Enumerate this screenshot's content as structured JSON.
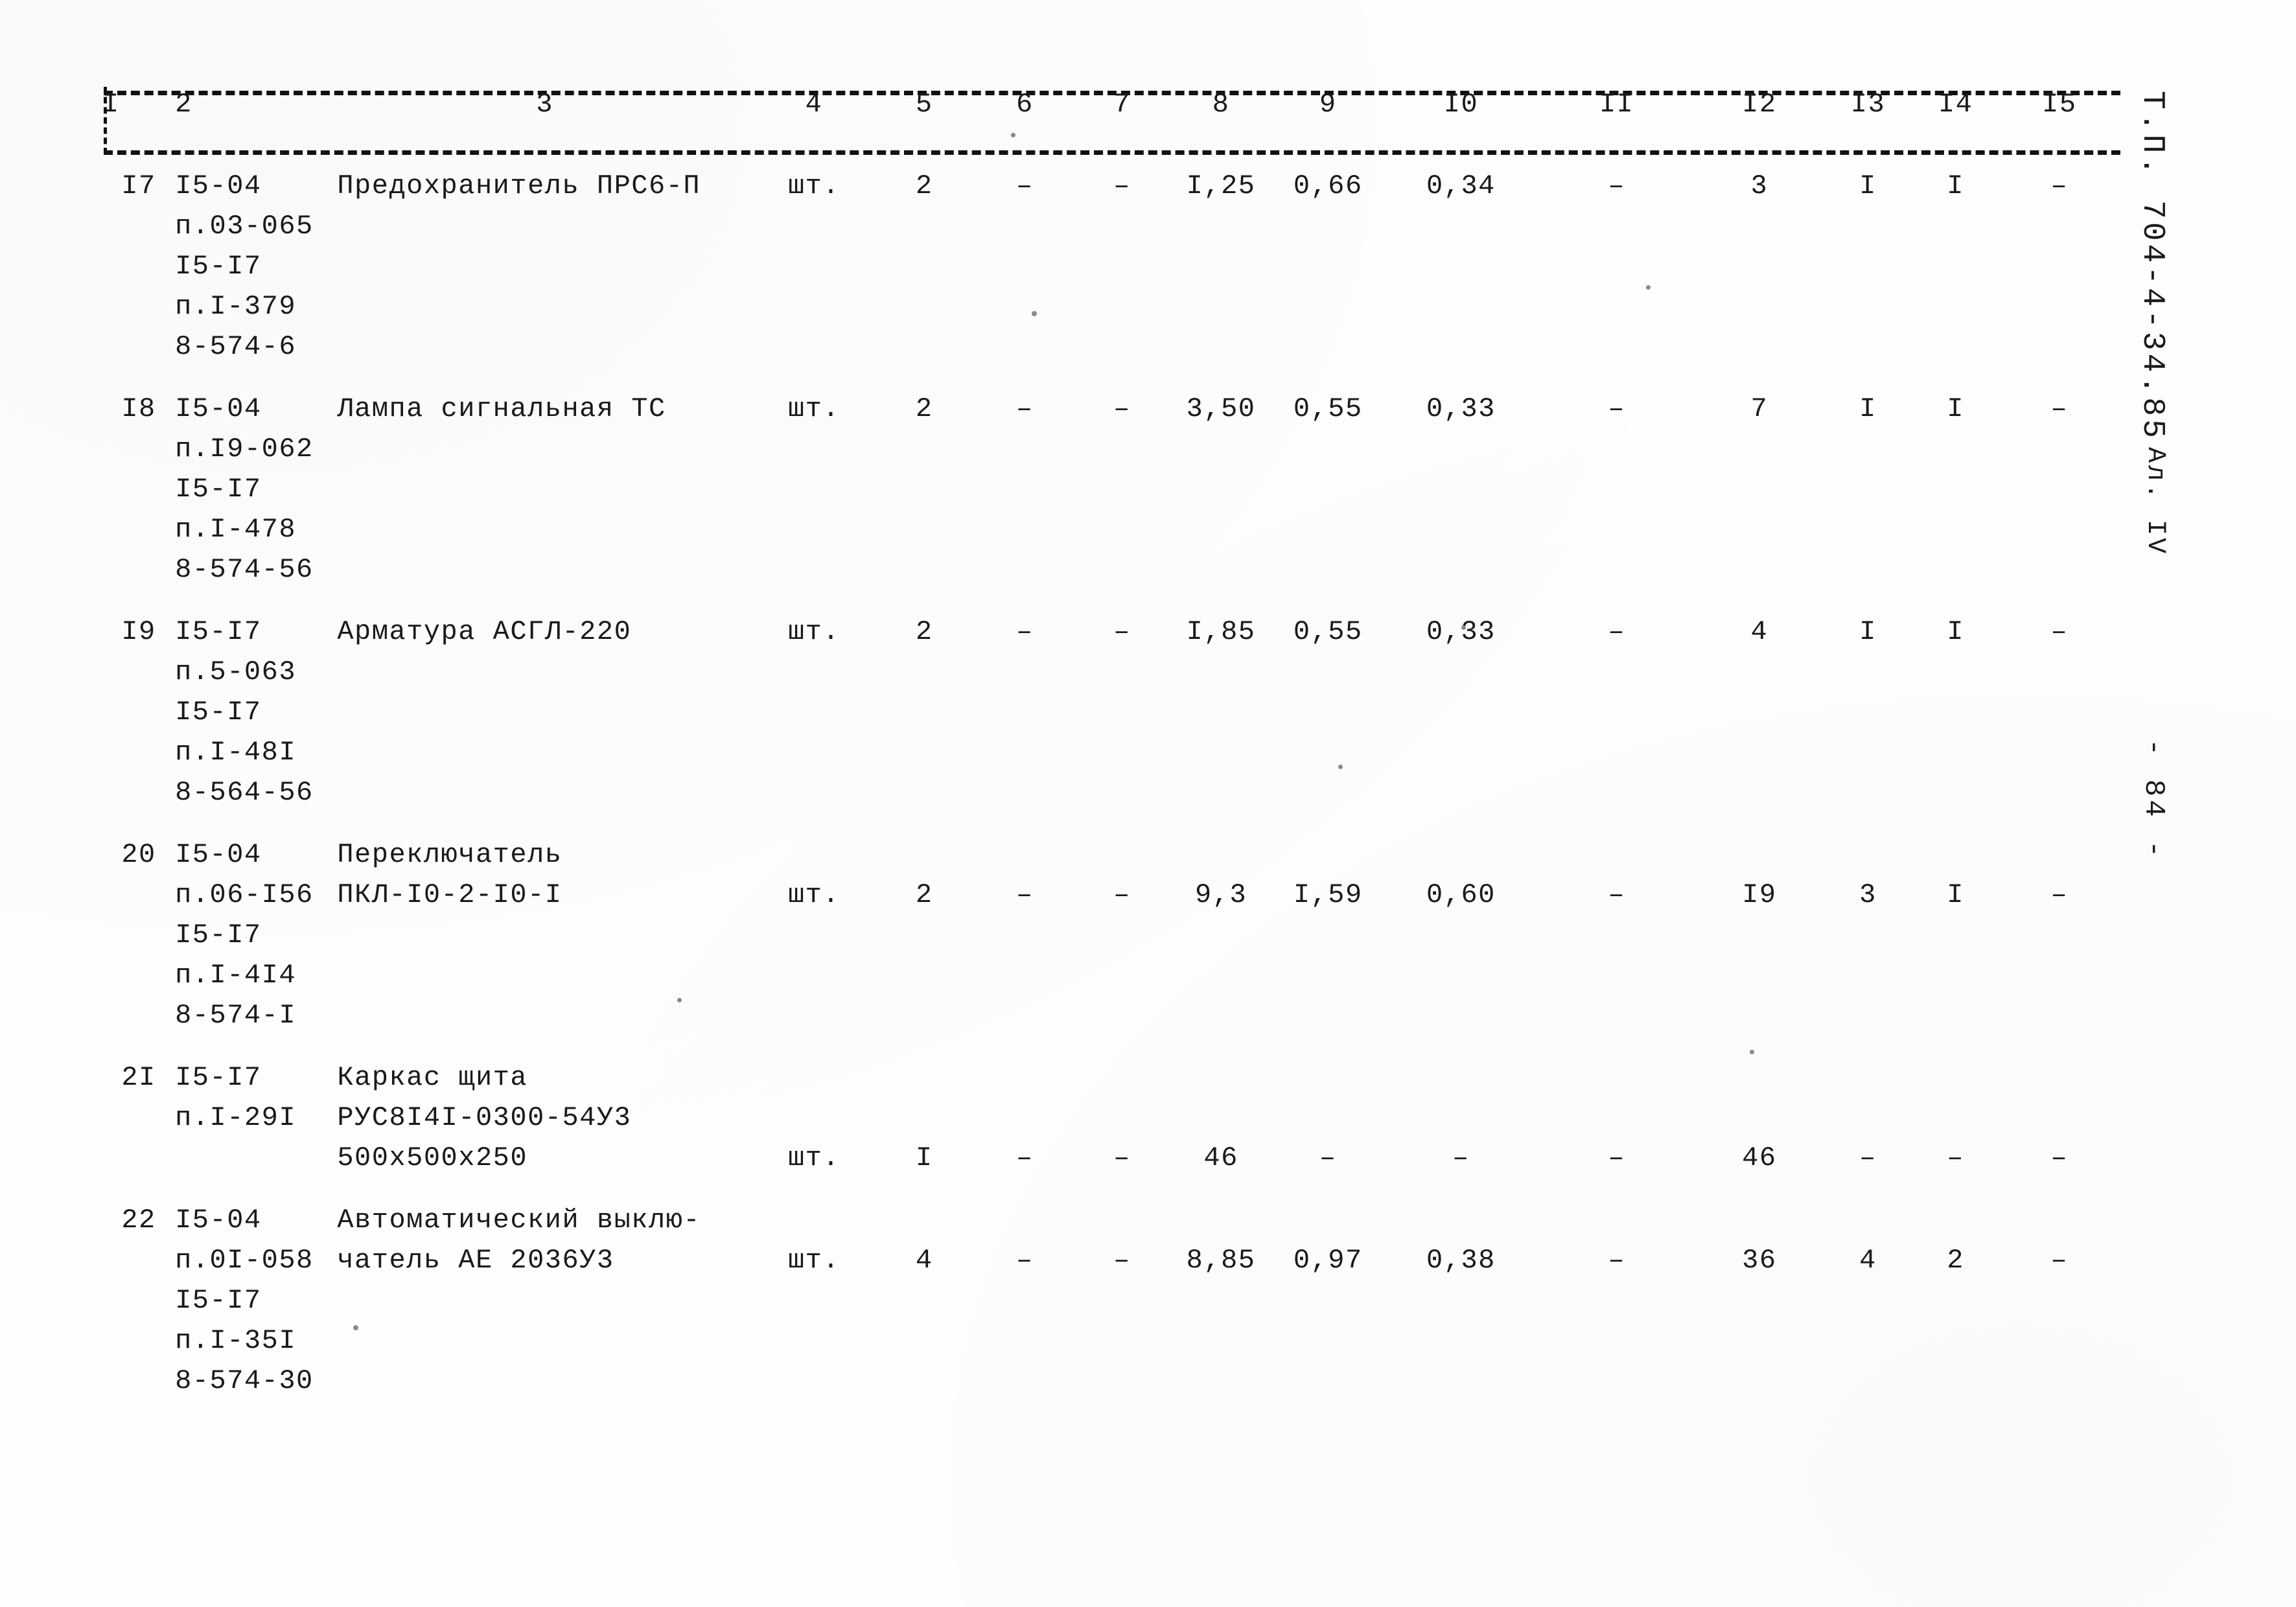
{
  "document": {
    "stamp_code": "Т.П. 704-4-34.85",
    "stamp_album": "Ал. IV",
    "stamp_page": "- 84 -"
  },
  "table": {
    "column_headers": [
      "I",
      "2",
      "3",
      "4",
      "5",
      "6",
      "7",
      "8",
      "9",
      "I0",
      "II",
      "I2",
      "I3",
      "I4",
      "I5"
    ],
    "rows": [
      {
        "no": "I7",
        "code_lines": [
          "I5-04",
          "п.03-065",
          "I5-I7",
          "п.I-379",
          "8-574-6"
        ],
        "name_lines": [
          "Предохранитель ПРС6-П"
        ],
        "unit": "шт.",
        "c5": "2",
        "c6": "–",
        "c7": "–",
        "c8": "I,25",
        "c9": "0,66",
        "c10": "0,34",
        "c11": "–",
        "c12": "3",
        "c13": "I",
        "c14": "I",
        "c15": "–"
      },
      {
        "no": "I8",
        "code_lines": [
          "I5-04",
          "п.I9-062",
          "I5-I7",
          "п.I-478",
          "8-574-56"
        ],
        "name_lines": [
          "Лампа сигнальная ТС"
        ],
        "unit": "шт.",
        "c5": "2",
        "c6": "–",
        "c7": "–",
        "c8": "3,50",
        "c9": "0,55",
        "c10": "0,33",
        "c11": "–",
        "c12": "7",
        "c13": "I",
        "c14": "I",
        "c15": "–"
      },
      {
        "no": "I9",
        "code_lines": [
          "I5-I7",
          "п.5-063",
          "I5-I7",
          "п.I-48I",
          "8-564-56"
        ],
        "name_lines": [
          "Арматура АСГЛ-220"
        ],
        "unit": "шт.",
        "c5": "2",
        "c6": "–",
        "c7": "–",
        "c8": "I,85",
        "c9": "0,55",
        "c10": "0,33",
        "c11": "–",
        "c12": "4",
        "c13": "I",
        "c14": "I",
        "c15": "–"
      },
      {
        "no": "20",
        "code_lines": [
          "I5-04",
          "п.06-I56",
          "I5-I7",
          "п.I-4I4",
          "8-574-I"
        ],
        "name_lines": [
          "Переключатель",
          "ПКЛ-I0-2-I0-I"
        ],
        "unit": "шт.",
        "c5": "2",
        "c6": "–",
        "c7": "–",
        "c8": "9,3",
        "c9": "I,59",
        "c10": "0,60",
        "c11": "–",
        "c12": "I9",
        "c13": "3",
        "c14": "I",
        "c15": "–"
      },
      {
        "no": "2I",
        "code_lines": [
          "I5-I7",
          "п.I-29I"
        ],
        "name_lines": [
          "Каркас щита",
          "РУС8I4I-0300-54У3",
          "500х500х250"
        ],
        "unit": "шт.",
        "c5": "I",
        "c6": "–",
        "c7": "–",
        "c8": "46",
        "c9": "–",
        "c10": "–",
        "c11": "–",
        "c12": "46",
        "c13": "–",
        "c14": "–",
        "c15": "–"
      },
      {
        "no": "22",
        "code_lines": [
          "I5-04",
          "п.0I-058",
          "I5-I7",
          "п.I-35I",
          "8-574-30"
        ],
        "name_lines": [
          "Автоматический выклю-",
          "чатель АЕ 2036У3"
        ],
        "unit": "шт.",
        "c5": "4",
        "c6": "–",
        "c7": "–",
        "c8": "8,85",
        "c9": "0,97",
        "c10": "0,38",
        "c11": "–",
        "c12": "36",
        "c13": "4",
        "c14": "2",
        "c15": "–"
      }
    ]
  }
}
